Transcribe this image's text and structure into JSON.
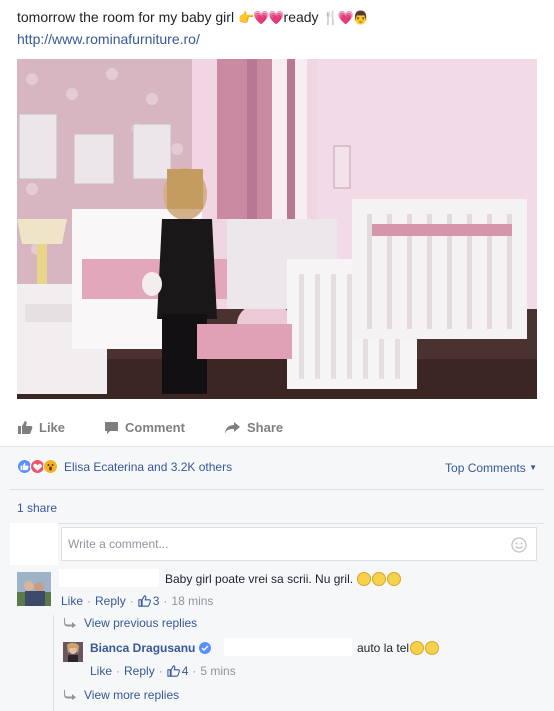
{
  "post": {
    "caption": "tomorrow the room for my baby girl",
    "caption_suffix": "ready",
    "caption_emojis_1": "👉💗💗",
    "caption_emojis_2": "🍴💗👨",
    "link": "http://www.rominafurniture.ro/"
  },
  "actions": {
    "like": "Like",
    "comment": "Comment",
    "share": "Share"
  },
  "reactions": {
    "summary": "Elisa Ecaterina and 3.2K others",
    "top_comments": "Top Comments",
    "shares": "1 share",
    "colors": {
      "like": "#5890ff",
      "love": "#f25268",
      "wow": "#f7b125"
    }
  },
  "composer": {
    "placeholder": "Write a comment..."
  },
  "comments": [
    {
      "text": "Baby girl poate vrei sa scrii. Nu gril.",
      "like": "Like",
      "reply": "Reply",
      "likes": "3",
      "time": "18 mins"
    }
  ],
  "replies": {
    "view_previous": "View previous replies",
    "view_more": "View more replies",
    "items": [
      {
        "author": "Bianca Dragusanu",
        "text": "auto la tel",
        "like": "Like",
        "reply": "Reply",
        "likes": "4",
        "time": "5 mins"
      }
    ]
  }
}
